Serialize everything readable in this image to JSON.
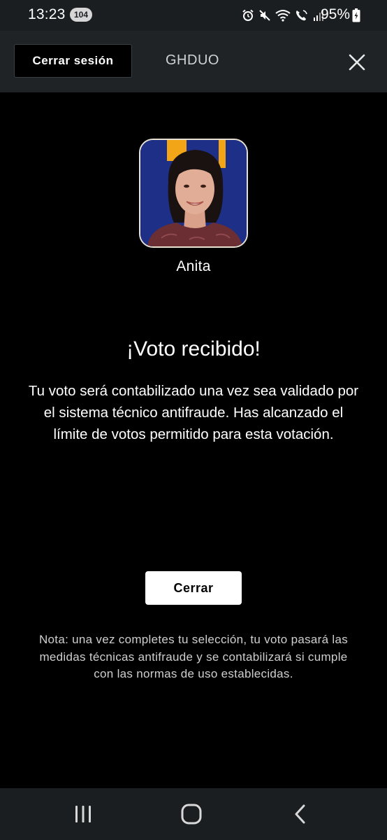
{
  "status_bar": {
    "time": "13:23",
    "notification_count": "104",
    "battery_percent": "95%",
    "icons": [
      "alarm-icon",
      "mute-icon",
      "wifi-icon",
      "volte-call-icon",
      "signal-icon",
      "battery-charging-icon"
    ]
  },
  "header": {
    "logout_label": "Cerrar sesión",
    "username": "GHDUO",
    "close_icon": "close-icon"
  },
  "candidate": {
    "name": "Anita"
  },
  "result": {
    "title": "¡Voto recibido!",
    "message": "Tu voto será contabilizado una vez sea validado por el sistema técnico antifraude. Has alcanzado el límite de votos permitido para esta votación.",
    "close_label": "Cerrar",
    "note": "Nota: una vez completes tu selección, tu voto pasará las medidas técnicas antifraude y se contabilizará si cumple con las normas de uso establecidas."
  },
  "nav_bar": {
    "buttons": [
      "recents-icon",
      "home-icon",
      "back-icon"
    ]
  },
  "colors": {
    "background": "#000000",
    "header_background": "#1f2326",
    "button_background": "#ffffff",
    "avatar_background": "#1d2f86",
    "avatar_accent": "#f2a516"
  }
}
